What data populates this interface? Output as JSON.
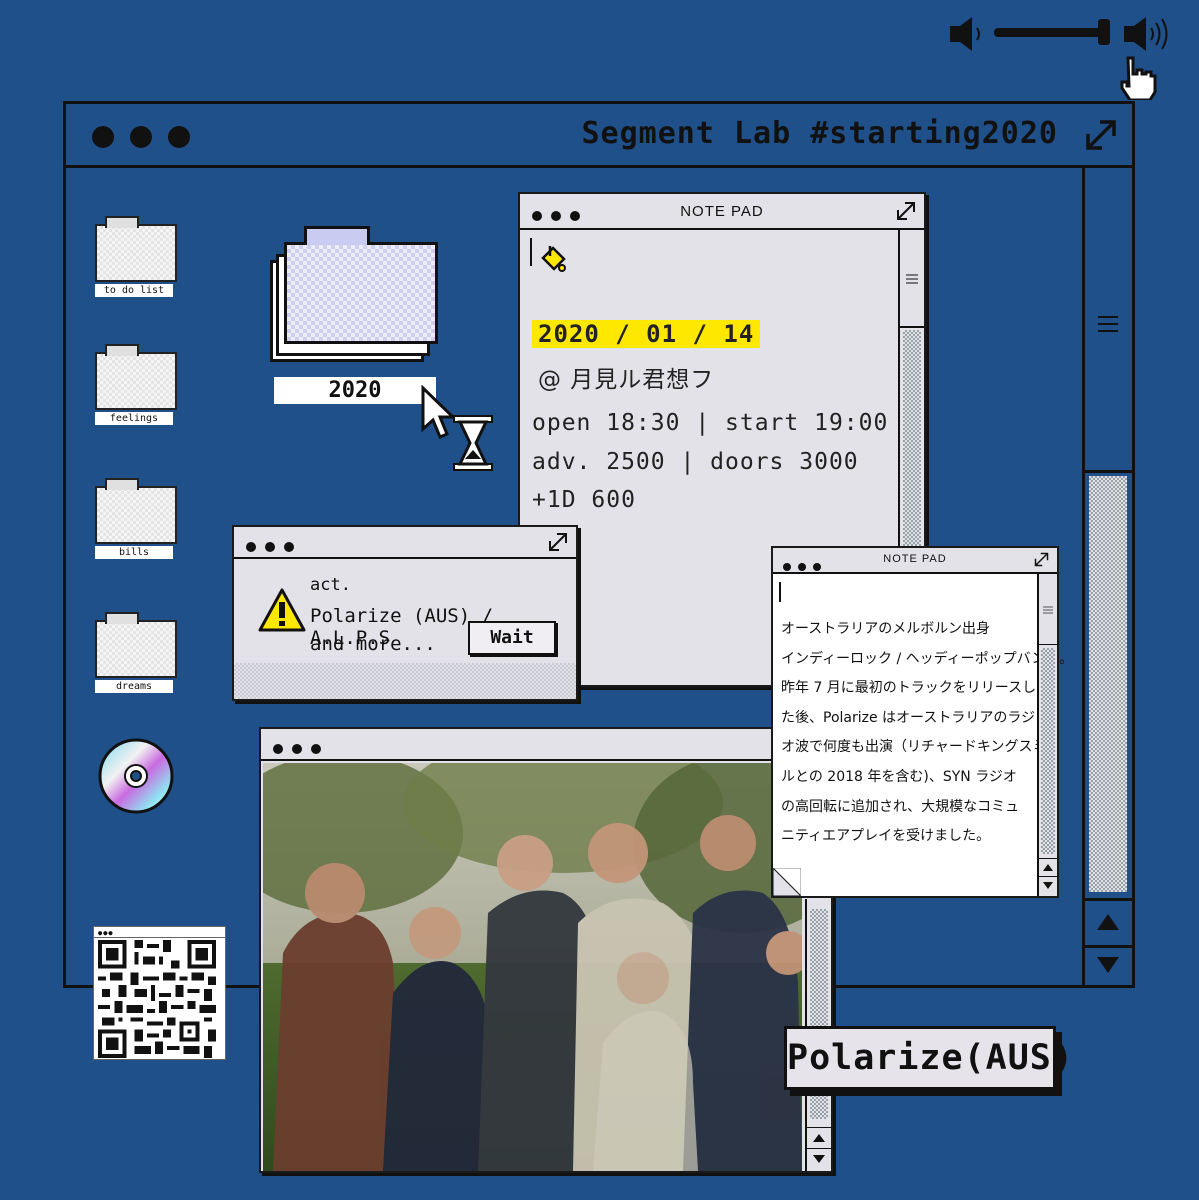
{
  "volume": {
    "level": 1.0,
    "min_icon": "speaker-low-icon",
    "max_icon": "speaker-high-icon"
  },
  "main_window": {
    "title": "Segment Lab #starting2020"
  },
  "desktop": {
    "folders": [
      {
        "label": "to do list"
      },
      {
        "label": "feelings"
      },
      {
        "label": "bills"
      },
      {
        "label": "dreams"
      }
    ],
    "big_folder_label": "2020"
  },
  "notepad1": {
    "title": "NOTE PAD",
    "date": "2020 / 01 / 14",
    "venue": "@ 月見ル君想フ",
    "line1": "open 18:30 | start 19:00",
    "line2": "adv. 2500 | doors 3000",
    "line3": "+1D 600"
  },
  "act_window": {
    "line1": "act.",
    "line2": "Polarize (AUS) / A.L.P.S",
    "line3": "and more...",
    "button": "Wait"
  },
  "notepad2": {
    "title": "NOTE PAD",
    "lines": [
      "オーストラリアのメルボルン出身",
      "インディーロック / ヘッディーポップバンド。",
      "昨年 7 月に最初のトラックをリリースし",
      "た後、Polarize はオーストラリアのラジ",
      "オ波で何度も出演（リチャードキングスミ",
      "ルとの 2018 年を含む)、SYN ラジオ",
      "の高回転に追加され、大規模なコミュ",
      "ニティエアプレイを受けました。"
    ]
  },
  "band_label": "Polarize(AUS)",
  "colors": {
    "background": "#20508a",
    "window": "#e4e2e9",
    "highlight": "#ffe800"
  }
}
